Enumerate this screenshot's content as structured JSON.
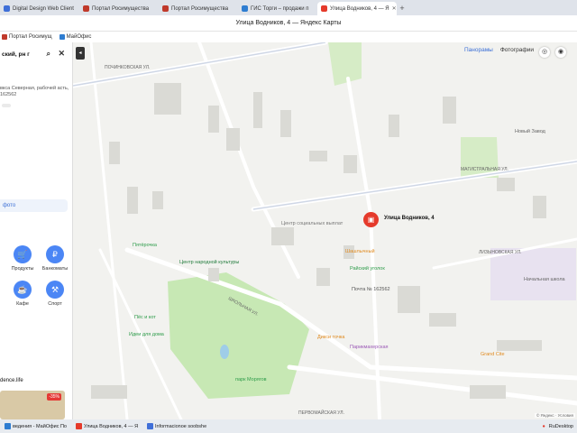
{
  "browser": {
    "tabs": [
      {
        "label": "Digital Design Web Client",
        "color": "#3f6fd8"
      },
      {
        "label": "Портал Росимущества",
        "color": "#c0392b"
      },
      {
        "label": "Портал Росимущества",
        "color": "#c0392b"
      },
      {
        "label": "ГИС Торги – продажи п",
        "color": "#2e7dd1"
      },
      {
        "label": "Улица Водников, 4 — Я",
        "color": "#e53a2b",
        "active": true
      }
    ],
    "window_title": "Улица Водников, 4 — Яндекс Карты",
    "bookmarks": [
      {
        "label": "Портал Росимущ",
        "color": "#c0392b"
      },
      {
        "label": "МайОфис",
        "color": "#2e7dd1"
      }
    ]
  },
  "sidebar": {
    "search_value": "ский, рн г",
    "address": "вкса Северная, рабочей асть, 162562",
    "photos_label": "фото",
    "categories": [
      {
        "label": "Продукты",
        "icon": "cart-icon"
      },
      {
        "label": "Банкоматы",
        "icon": "ruble-icon"
      },
      {
        "label": "Кафе",
        "icon": "cup-icon"
      },
      {
        "label": "Спорт",
        "icon": "dumbbell-icon"
      }
    ],
    "site": "dence.life",
    "promo_badge": "-35%"
  },
  "map": {
    "tabs": {
      "panoramas": "Панорамы",
      "photos": "Фотографии"
    },
    "pin_label": "Улица Водников, 4",
    "streets": [
      "ПОЧИНКОВСКАЯ УЛ.",
      "МАГИСТРАЛЬНАЯ УЛ.",
      "ШКОЛЬНАЯ УЛ.",
      "ПЕРВОМАЙСКАЯ УЛ.",
      "ЛИЗЫНОВСКАЯ УЛ."
    ],
    "pois": [
      {
        "label": "Пятёрочка",
        "color": "#2e9c4a"
      },
      {
        "label": "Центр народной культуры",
        "color": "#1f7a3a"
      },
      {
        "label": "Центр социальных выплат",
        "color": "#777777"
      },
      {
        "label": "Шашлычный",
        "color": "#e08a1e"
      },
      {
        "label": "Райский уголок",
        "color": "#2e9c4a"
      },
      {
        "label": "Почта № 162562",
        "color": "#555555"
      },
      {
        "label": "Пёс и кот",
        "color": "#2e9c4a"
      },
      {
        "label": "Идеи для дома",
        "color": "#2e9c4a"
      },
      {
        "label": "Дикси точка",
        "color": "#e08a1e"
      },
      {
        "label": "Парикмахерская",
        "color": "#9b59b6"
      },
      {
        "label": "Grand Cite",
        "color": "#e08a1e"
      },
      {
        "label": "парк Морягов",
        "color": "#2e9c4a"
      },
      {
        "label": "Начальная школа",
        "color": "#666666"
      },
      {
        "label": "Новый Завод",
        "color": "#666666"
      }
    ],
    "copyright": "© Яндекс · Условия"
  },
  "taskbar": [
    {
      "label": "ведения - МайОфис По",
      "color": "#2e7dd1"
    },
    {
      "label": "Улица Водников, 4 — Я",
      "color": "#e53a2b"
    },
    {
      "label": "Informacionoe soobshe",
      "color": "#3f6fd8"
    }
  ],
  "tray": {
    "app": "RuDesktop"
  }
}
